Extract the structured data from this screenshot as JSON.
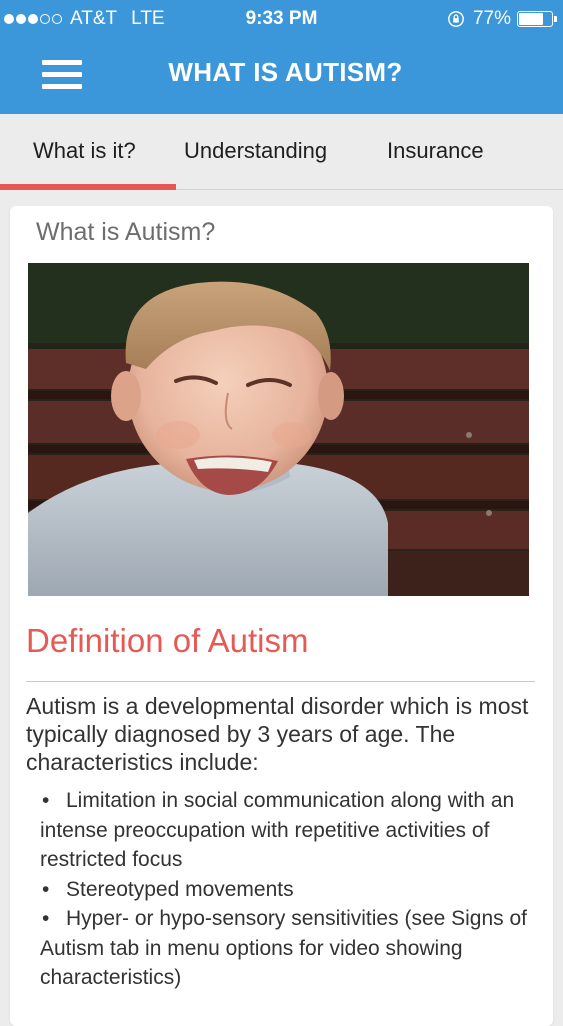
{
  "status_bar": {
    "carrier": "AT&T",
    "network": "LTE",
    "time": "9:33 PM",
    "battery_text": "77%",
    "battery_level": 0.77,
    "signal_bars_filled": 3,
    "signal_bars_total": 5
  },
  "header": {
    "title": "WHAT IS AUTISM?",
    "menu_icon": "hamburger-menu-icon",
    "background_color": "#3b97d9"
  },
  "tabs": [
    {
      "label": "What is it?",
      "active": true
    },
    {
      "label": "Understanding",
      "active": false
    },
    {
      "label": "Insurance",
      "active": false
    }
  ],
  "accent_color": "#e55a55",
  "content": {
    "card_heading": "What is Autism?",
    "section_title": "Definition of Autism",
    "intro": "Autism is a developmental disorder which is most typically diagnosed by 3 years of age. The characteristics include:",
    "bullets": [
      "Limitation in social communication along with an intense preoccupation with repetitive activities of restricted focus",
      "Stereotyped movements",
      "Hyper- or hypo-sensory sensitivities (see Signs of Autism tab in menu options for video showing characteristics)"
    ]
  }
}
